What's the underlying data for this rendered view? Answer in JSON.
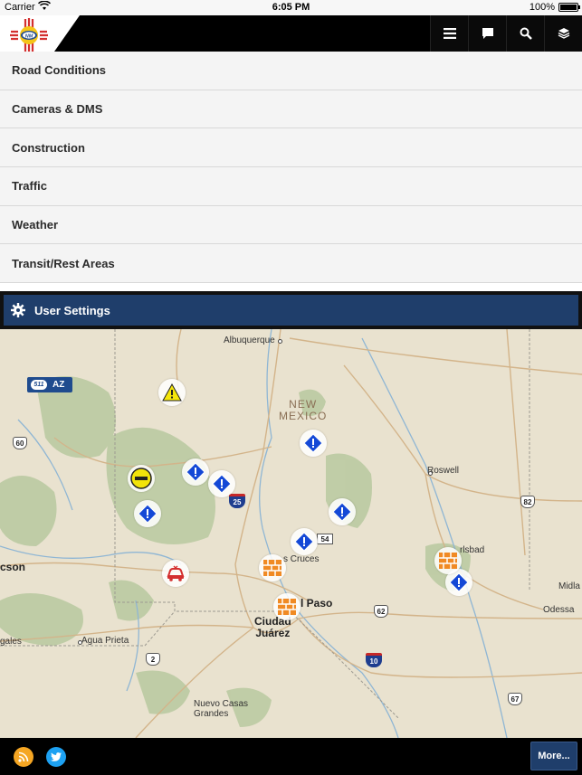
{
  "status_bar": {
    "carrier": "Carrier",
    "time": "6:05 PM",
    "battery": "100%"
  },
  "header": {
    "logo_text": "NM",
    "buttons": [
      "menu-icon",
      "chat-icon",
      "search-icon",
      "layers-icon"
    ]
  },
  "menu": {
    "items": [
      {
        "label": "Road Conditions"
      },
      {
        "label": "Cameras & DMS"
      },
      {
        "label": "Construction"
      },
      {
        "label": "Traffic"
      },
      {
        "label": "Weather"
      },
      {
        "label": "Transit/Rest Areas"
      }
    ],
    "user_settings": "User Settings"
  },
  "map": {
    "az_badge": "AZ",
    "places": {
      "albuquerque": "Albuquerque",
      "new_mexico": "NEW\nMEXICO",
      "roswell": "Roswell",
      "las_cruces": "s Cruces",
      "carlsbad": "rlsbad",
      "el_paso": "l Paso",
      "ciudad_juarez": "Ciudad\nJuárez",
      "tucson": "cson",
      "agua_prieta": "Agua Prieta",
      "nogales": "gales",
      "nuevo_casas_grandes": "Nuevo Casas\nGrandes",
      "midland": "Midla",
      "odessa": "Odessa"
    },
    "shields": {
      "us60": "60",
      "i25": "25",
      "sh54": "54",
      "us82": "82",
      "us62": "62",
      "i10": "10",
      "us67": "67",
      "mx2": "2"
    },
    "markers": [
      {
        "type": "warning",
        "name": "warning-icon"
      },
      {
        "type": "closure",
        "name": "road-closure-icon"
      },
      {
        "type": "incident",
        "name": "incident-icon"
      },
      {
        "type": "construction",
        "name": "construction-icon"
      },
      {
        "type": "crash",
        "name": "crash-icon"
      }
    ],
    "colors": {
      "incident": "#1448d6",
      "warning": "#f5e60b",
      "closure": "#f2e30a",
      "construction": "#f08a24",
      "crash": "#d32f2f"
    }
  },
  "footer": {
    "rss": "rss-icon",
    "twitter": "twitter-icon",
    "more": "More..."
  }
}
